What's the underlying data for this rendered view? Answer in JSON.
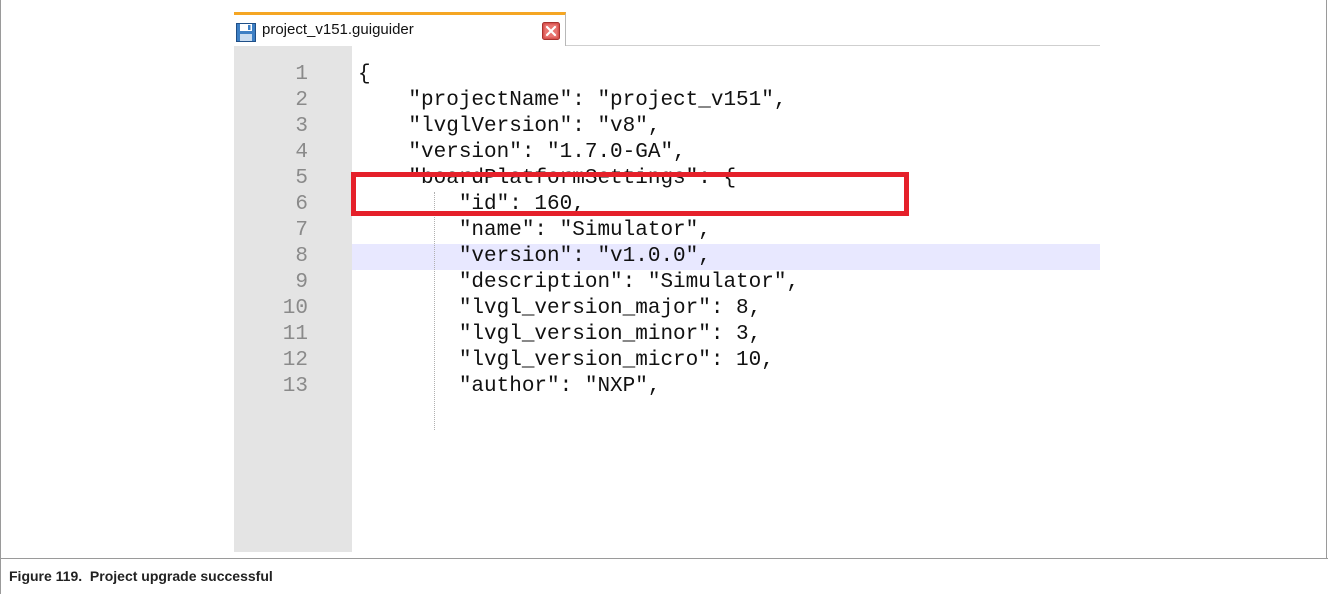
{
  "editor": {
    "tab": {
      "title": "project_v151.guiguider",
      "save_icon": "save-icon",
      "close_icon": "close-icon"
    },
    "current_line": 8,
    "lines": [
      {
        "number": "1",
        "text": "{"
      },
      {
        "number": "2",
        "text": "    \"projectName\": \"project_v151\","
      },
      {
        "number": "3",
        "text": "    \"lvglVersion\": \"v8\","
      },
      {
        "number": "4",
        "text": "    \"version\": \"1.7.0-GA\","
      },
      {
        "number": "5",
        "text": "    \"boardPlatformSettings\": {"
      },
      {
        "number": "6",
        "text": "        \"id\": 160,"
      },
      {
        "number": "7",
        "text": "        \"name\": \"Simulator\","
      },
      {
        "number": "8",
        "text": "        \"version\": \"v1.0.0\","
      },
      {
        "number": "9",
        "text": "        \"description\": \"Simulator\","
      },
      {
        "number": "10",
        "text": "        \"lvgl_version_major\": 8,"
      },
      {
        "number": "11",
        "text": "        \"lvgl_version_minor\": 3,"
      },
      {
        "number": "12",
        "text": "        \"lvgl_version_micro\": 10,"
      },
      {
        "number": "13",
        "text": "        \"author\": \"NXP\","
      }
    ]
  },
  "highlight": {
    "line": 4,
    "color": "#e5202a"
  },
  "caption": {
    "text": "Figure 119.  Project upgrade successful"
  },
  "colors": {
    "tab_accent": "#f5a623",
    "gutter": "#e4e4e4",
    "current_line": "#e8e8ff"
  }
}
